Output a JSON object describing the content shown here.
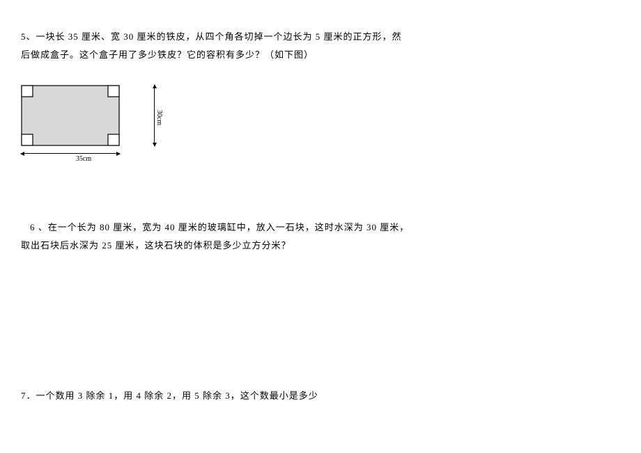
{
  "problems": {
    "p5": {
      "line1": "5、一块长 35 厘米、宽 30 厘米的铁皮，从四个角各切掉一个边长为 5 厘米的正方形，然",
      "line2": "后做成盒子。这个盒子用了多少铁皮？它的容积有多少？（如下图）"
    },
    "diagram": {
      "width_label": "35cm",
      "height_label": "30cm",
      "rect_w_cm": 35,
      "rect_h_cm": 30,
      "cut_square_cm": 5
    },
    "p6": {
      "line1": "6 、在一个长为 80 厘米，宽为 40 厘米的玻璃缸中，放入一石块，这时水深为 30 厘米，",
      "line2": "取出石块后水深为 25 厘米，这块石块的体积是多少立方分米？"
    },
    "p7": {
      "line1": "7．一个数用 3 除余 1，用 4 除余 2，用 5 除余 3，这个数最小是多少"
    }
  }
}
